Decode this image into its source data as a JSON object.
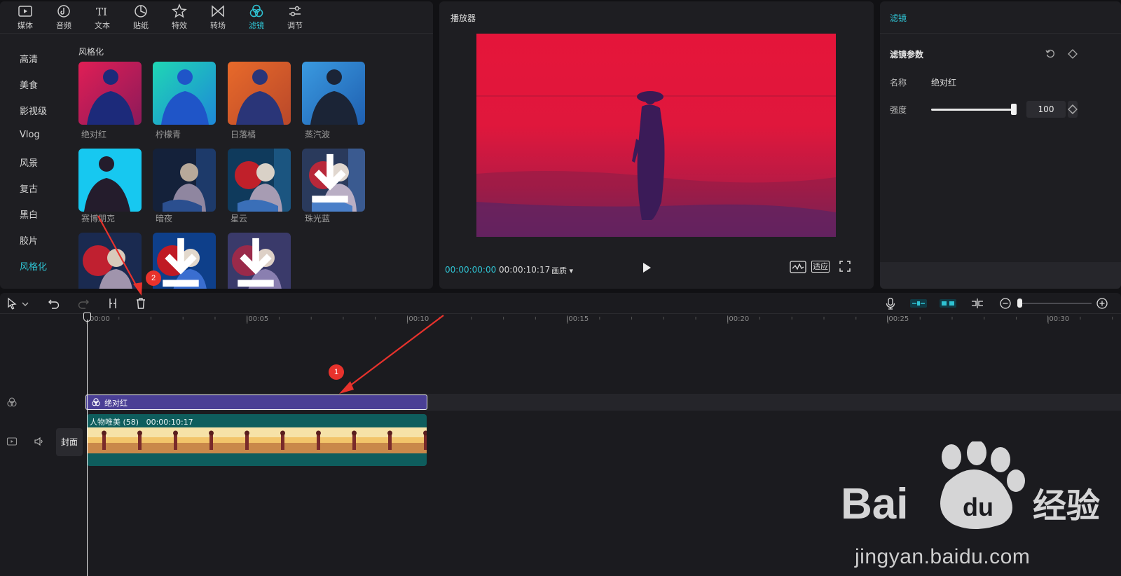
{
  "media_tabs": [
    {
      "label": "媒体",
      "icon": "media-icon"
    },
    {
      "label": "音频",
      "icon": "audio-icon"
    },
    {
      "label": "文本",
      "icon": "text-icon"
    },
    {
      "label": "贴纸",
      "icon": "sticker-icon"
    },
    {
      "label": "特效",
      "icon": "effects-icon"
    },
    {
      "label": "转场",
      "icon": "transition-icon"
    },
    {
      "label": "滤镜",
      "icon": "filter-icon",
      "active": true
    },
    {
      "label": "调节",
      "icon": "adjust-icon"
    }
  ],
  "filter_categories": [
    "高清",
    "美食",
    "影视级",
    "Vlog",
    "风景",
    "复古",
    "黑白",
    "胶片",
    "风格化"
  ],
  "active_category": "风格化",
  "grid": {
    "title": "风格化",
    "items": [
      "绝对红",
      "柠檬青",
      "日落橘",
      "蒸汽波",
      "赛博朋克",
      "暗夜",
      "星云",
      "珠光蓝",
      "",
      "",
      ""
    ]
  },
  "player": {
    "title": "播放器",
    "current_time": "00:00:00:00",
    "duration": "00:00:10:17",
    "quality_label": "画质",
    "fit_label": "适应"
  },
  "props": {
    "header": "滤镜",
    "section_title": "滤镜参数",
    "name_label": "名称",
    "name_value": "绝对红",
    "strength_label": "强度",
    "strength_value": "100",
    "strength_fraction": 1.0
  },
  "timeline": {
    "ticks": [
      "00:00",
      "|00:05",
      "|00:10",
      "|00:15",
      "|00:20",
      "|00:25",
      "|00:30"
    ],
    "filter_clip_name": "绝对红",
    "video_clip_name": "人物唯美 (58)",
    "video_clip_duration": "00:00:10:17",
    "cover_label": "封面"
  },
  "annotations": {
    "badge1": "1",
    "badge2": "2",
    "arrow_color": "#e8322c"
  },
  "watermark": {
    "logo": "Baidu 经验",
    "url": "jingyan.baidu.com"
  },
  "colors": {
    "accent": "#2fc3d3",
    "filter_clip": "#4a3f95",
    "video_clip": "#0e5d5d",
    "red_preview": "#e0173a"
  }
}
